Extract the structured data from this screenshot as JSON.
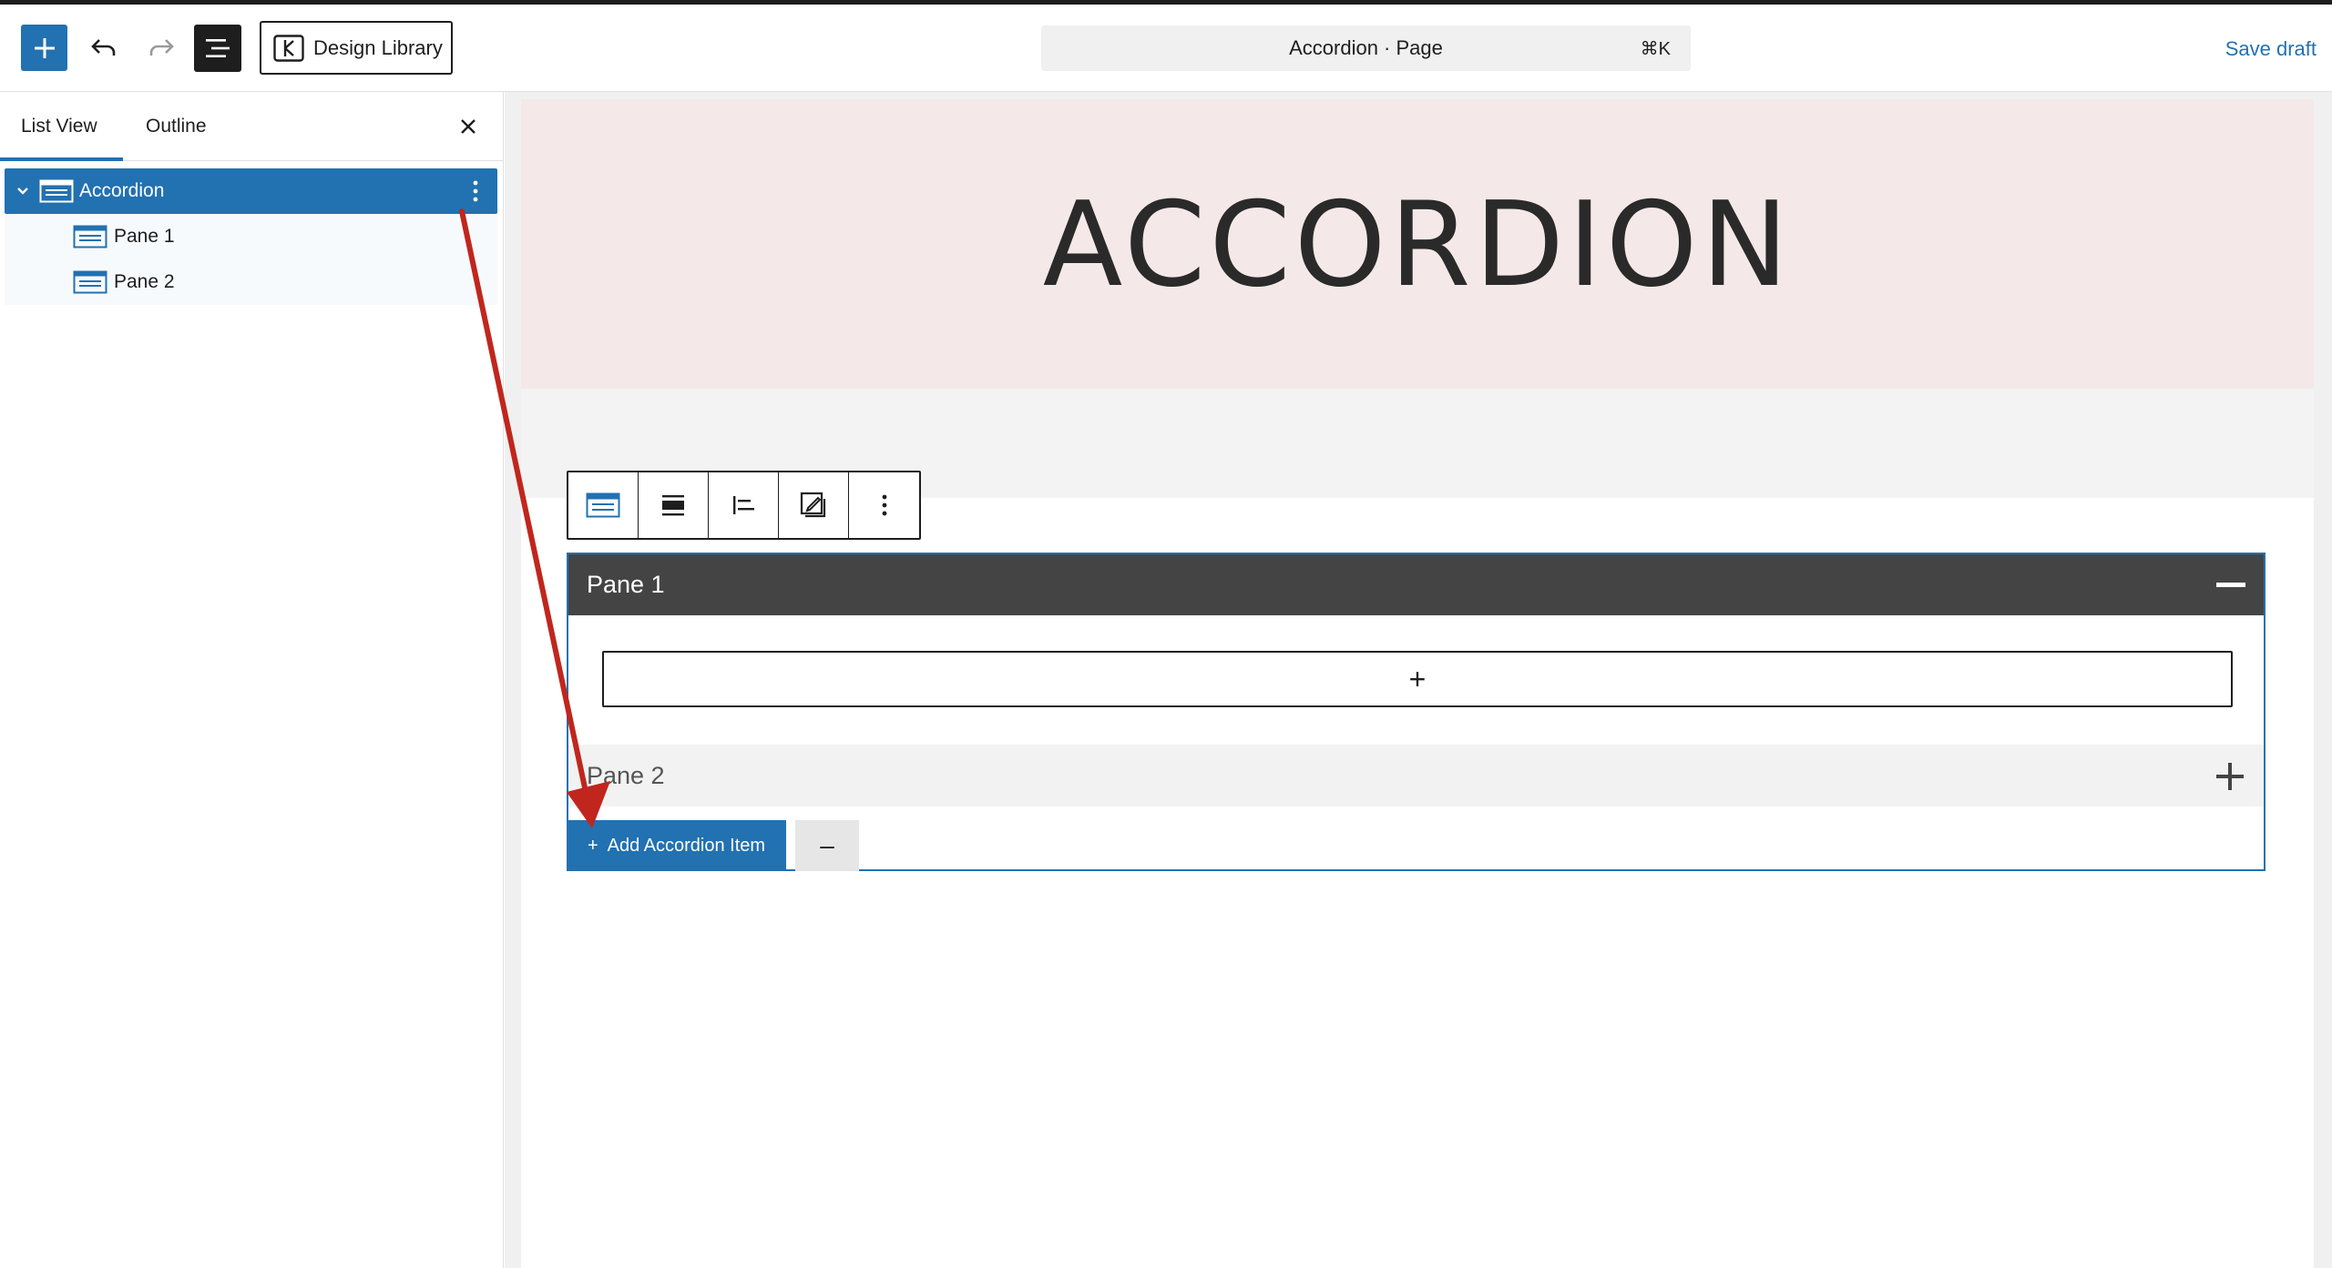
{
  "toolbar": {
    "add_block_icon": "plus-icon",
    "undo_icon": "undo-icon",
    "redo_icon": "redo-icon",
    "list_view_icon": "list-view-icon",
    "design_library_label": "Design Library",
    "command_title": "Accordion · Page",
    "command_shortcut": "⌘K",
    "save_draft_label": "Save draft"
  },
  "sidebar": {
    "tabs": [
      {
        "label": "List View",
        "active": true
      },
      {
        "label": "Outline",
        "active": false
      }
    ],
    "close_icon": "close-icon",
    "tree": [
      {
        "label": "Accordion",
        "selected": true
      },
      {
        "label": "Pane 1",
        "selected": false
      },
      {
        "label": "Pane 2",
        "selected": false
      }
    ]
  },
  "canvas": {
    "hero_title": "ACCORDION",
    "accordion": {
      "pane1_title": "Pane 1",
      "appender_label": "+",
      "pane2_title": "Pane 2",
      "add_item_label": "Add Accordion Item",
      "add_item_icon": "+",
      "remove_item_label": "–"
    }
  },
  "colors": {
    "accent": "#2271b1",
    "hero_bg": "#f4e9e8",
    "pane_header": "#444444",
    "annotation_arrow": "#c0261d"
  }
}
